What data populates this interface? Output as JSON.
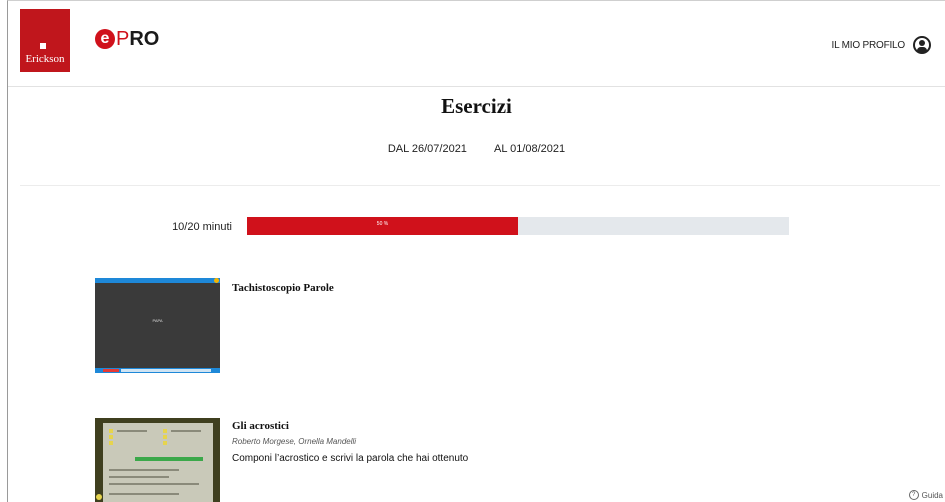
{
  "header": {
    "brand_logo_text": "Erickson",
    "app_logo": {
      "e": "e",
      "p": "P",
      "ro": "RO"
    },
    "profile_label": "IL MIO PROFILO",
    "accent_color": "#d0111b"
  },
  "page": {
    "title": "Esercizi",
    "date_from": "DAL 26/07/2021",
    "date_to": "AL 01/08/2021"
  },
  "progress": {
    "minutes_label": "10/20 minuti",
    "percent_label": "50 %",
    "fraction": 0.5
  },
  "exercises": [
    {
      "title": "Tachistoscopio Parole",
      "thumb_text": "PAPA"
    },
    {
      "title": "Gli acrostici",
      "authors": "Roberto Morgese, Ornella Mandelli",
      "description": "Componi l’acrostico e scrivi la parola che hai ottenuto"
    }
  ],
  "help": {
    "label": "Guida",
    "icon": "help-circle-icon"
  }
}
